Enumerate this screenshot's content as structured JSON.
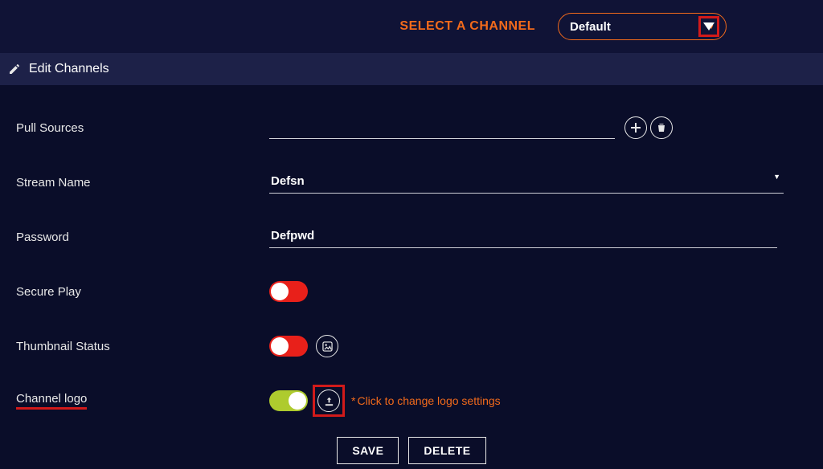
{
  "header": {
    "select_channel_label": "SELECT A CHANNEL",
    "selected_channel": "Default"
  },
  "section_title": "Edit Channels",
  "labels": {
    "pull_sources": "Pull Sources",
    "stream_name": "Stream Name",
    "password": "Password",
    "secure_play": "Secure Play",
    "thumbnail_status": "Thumbnail Status",
    "channel_logo": "Channel logo"
  },
  "values": {
    "pull_sources": "",
    "stream_name": "Defsn",
    "password": "Defpwd"
  },
  "toggles": {
    "secure_play": "off",
    "thumbnail_status": "off",
    "channel_logo": "on"
  },
  "hints": {
    "logo": "Click to change logo settings"
  },
  "buttons": {
    "save": "SAVE",
    "delete": "DELETE"
  },
  "icons": {
    "edit": "edit-icon",
    "add": "add-icon",
    "trash": "trash-icon",
    "image": "image-icon",
    "upload": "upload-icon",
    "caret": "caret-down-icon"
  },
  "colors": {
    "accent": "#f26a1b",
    "danger": "#d21a1a",
    "toggle_off": "#e8201a",
    "toggle_on": "#aecb2e"
  }
}
